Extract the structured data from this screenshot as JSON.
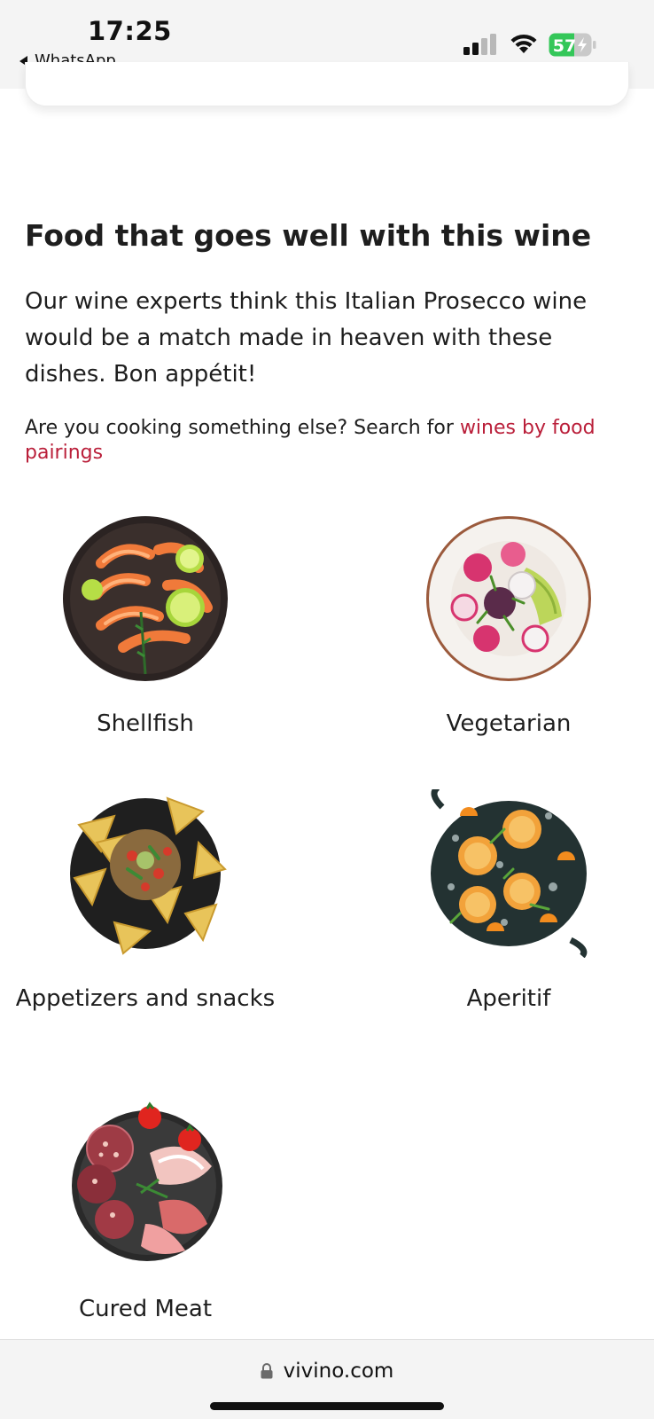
{
  "status_bar": {
    "time": "17:25",
    "back_app": "WhatsApp",
    "battery_level": "57",
    "battery_color": "#34c759"
  },
  "section": {
    "title": "Food that goes well with this wine",
    "description": "Our wine experts think this Italian Prosecco wine would be a match made in heaven with these dishes. Bon appétit!",
    "search_prefix": "Are you cooking something else? Search for ",
    "search_link": "wines by food pairings",
    "link_color": "#ba1f3a"
  },
  "foods": [
    {
      "label": "Shellfish",
      "icon": "shrimp-plate-icon"
    },
    {
      "label": "Vegetarian",
      "icon": "salad-plate-icon"
    },
    {
      "label": "Appetizers and snacks",
      "icon": "nachos-plate-icon"
    },
    {
      "label": "Aperitif",
      "icon": "aperitif-tray-icon"
    },
    {
      "label": "Cured Meat",
      "icon": "charcuterie-plate-icon"
    }
  ],
  "browser": {
    "url": "vivino.com"
  }
}
